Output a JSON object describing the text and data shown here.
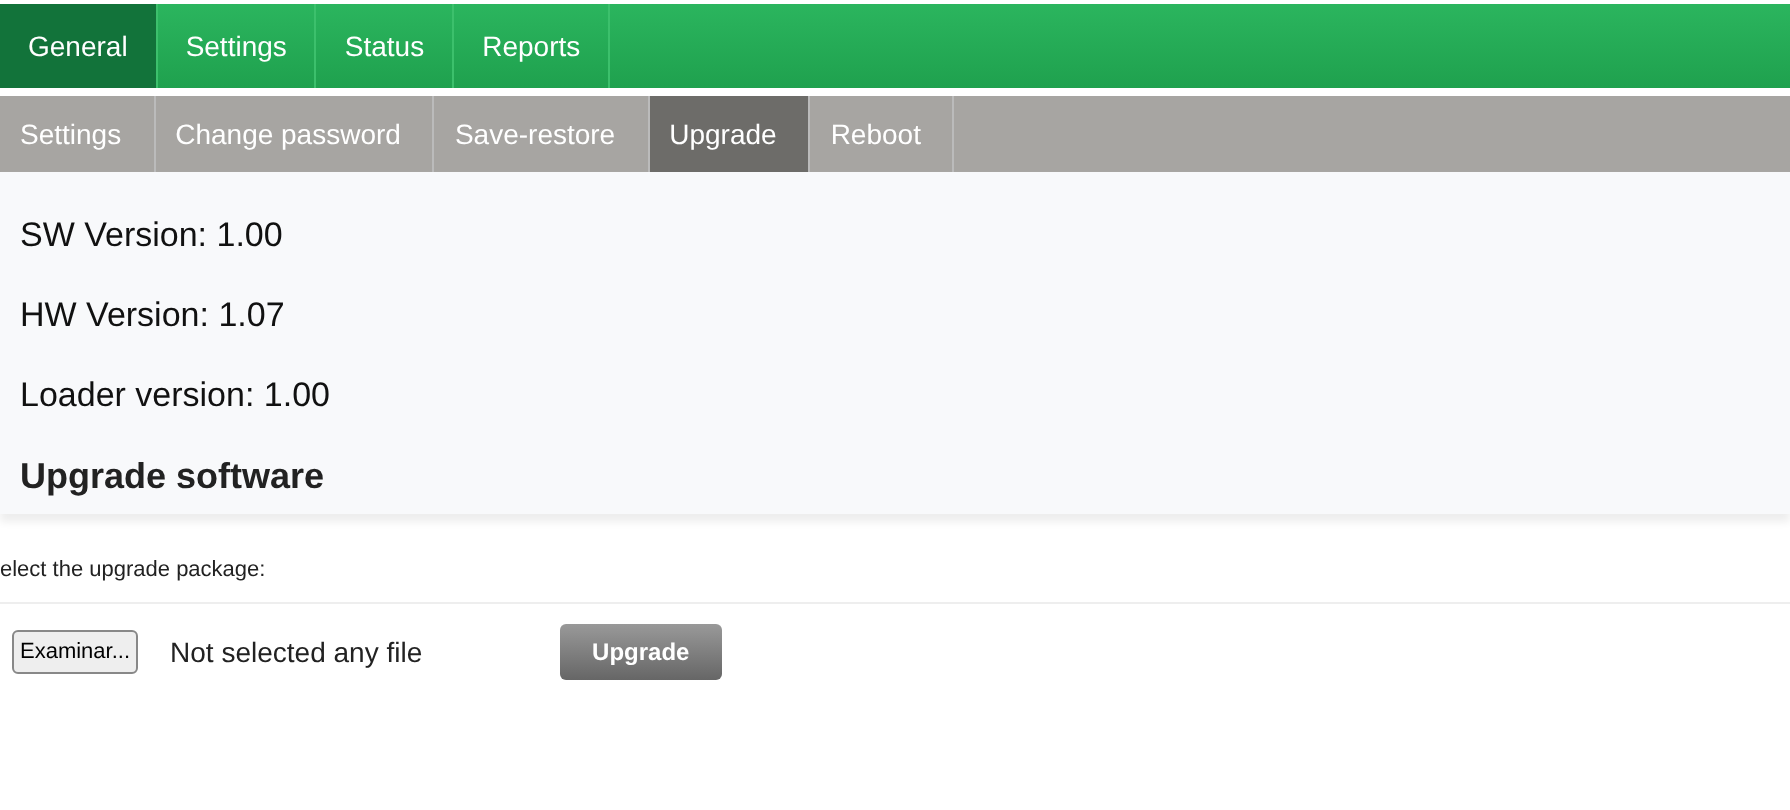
{
  "main_tabs": [
    {
      "label": "General",
      "selected": true
    },
    {
      "label": "Settings",
      "selected": false
    },
    {
      "label": "Status",
      "selected": false
    },
    {
      "label": "Reports",
      "selected": false
    }
  ],
  "sub_tabs": [
    {
      "label": "Settings",
      "selected": false
    },
    {
      "label": "Change password",
      "selected": false
    },
    {
      "label": "Save-restore",
      "selected": false
    },
    {
      "label": "Upgrade",
      "selected": true
    },
    {
      "label": "Reboot",
      "selected": false
    }
  ],
  "info": [
    "SW Version: 1.00",
    "HW Version: 1.07",
    "Loader version: 1.00"
  ],
  "section_title": "Upgrade software",
  "instruction": "elect the upgrade package:",
  "browse_button": "Examinar...",
  "file_status": "Not selected any file",
  "upgrade_button": "Upgrade"
}
